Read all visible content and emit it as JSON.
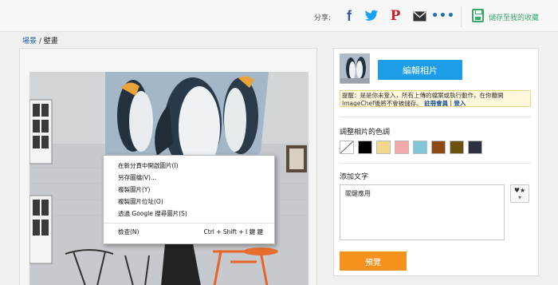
{
  "topbar": {
    "share_label": "分享:",
    "icons": [
      "facebook-icon",
      "twitter-icon",
      "pinterest-icon",
      "mail-icon",
      "more-icon"
    ],
    "save_label": "儲存至我的收藏"
  },
  "breadcrumb": {
    "home": "場景",
    "current": "/ 壁畫"
  },
  "context_menu": {
    "items": [
      "在新分頁中開啟圖片(I)",
      "另存圖檔(V)...",
      "複製圖片(Y)",
      "複製圖片位址(O)",
      "透過 Google 搜尋圖片(S)"
    ],
    "inspect_label": "檢查(N)",
    "inspect_shortcut": "Ctrl + Shift + I 鍵 鍵"
  },
  "editor": {
    "edit_button": "編輯相片",
    "notice_text": "提醒：是是你未登入，所有上傳的檔案或執行動作，在你離開 ImageChef後將不會被儲存。",
    "notice_join": "註冊會員",
    "notice_sep": " | ",
    "notice_login": "登入",
    "color_title": "調整相片的色調",
    "colors": [
      "none",
      "#000000",
      "#f0d98c",
      "#f2a9a8",
      "#7fc7d6",
      "#8b4a14",
      "#6b5212",
      "#2b3140"
    ],
    "text_title": "添加文字",
    "text_value": "關鍵應用",
    "font_button": "♥★",
    "preview_button": "預覽"
  }
}
